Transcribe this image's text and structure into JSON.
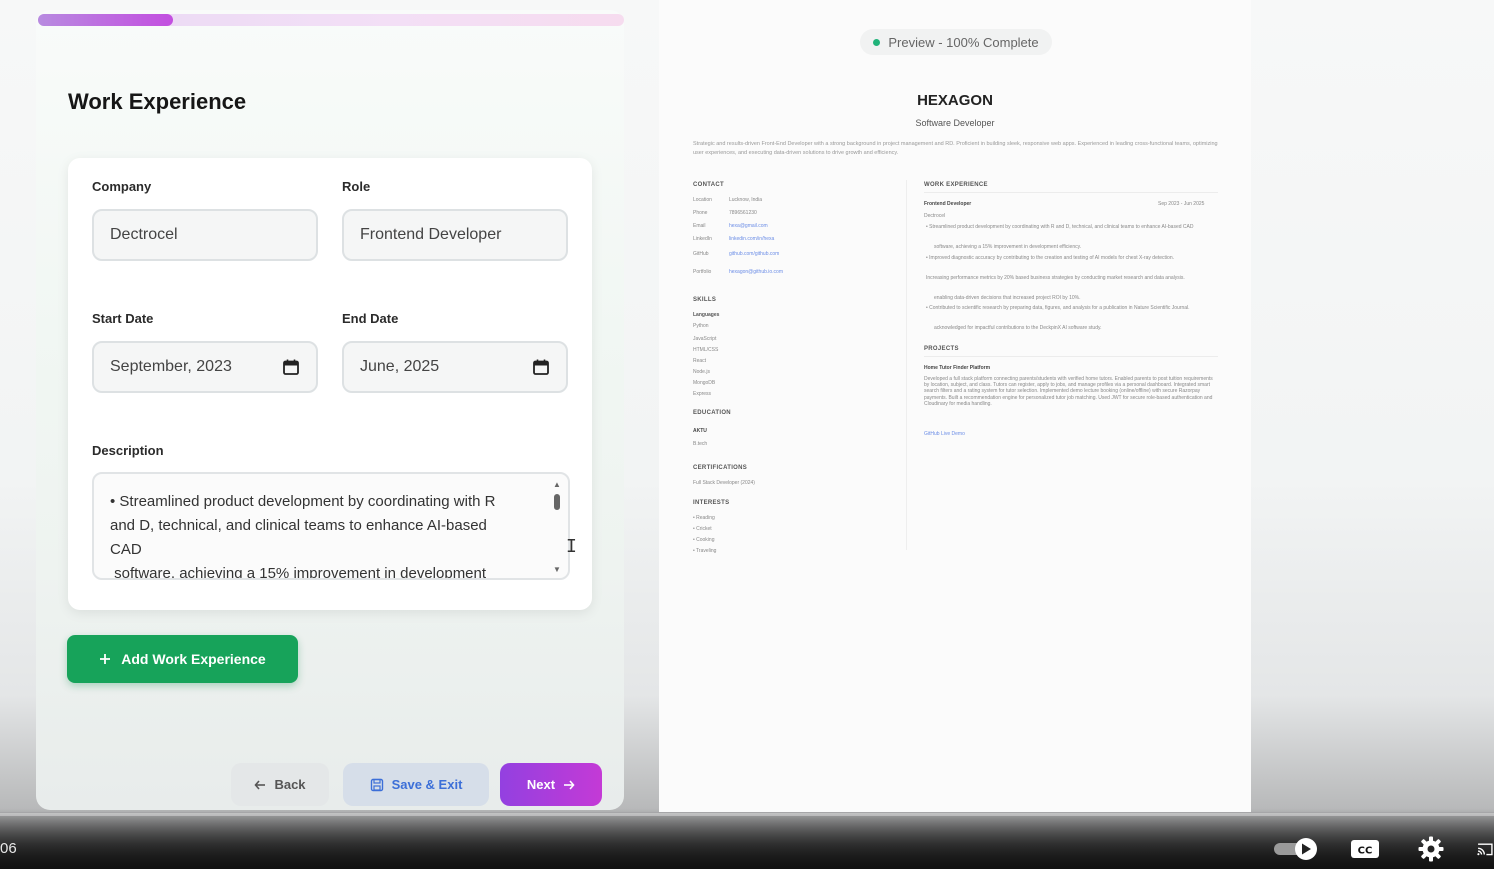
{
  "progress": {
    "fraction": 0.23
  },
  "section": {
    "title": "Work Experience"
  },
  "form": {
    "company_label": "Company",
    "company_value": "Dectrocel",
    "role_label": "Role",
    "role_value": "Frontend Developer",
    "start_label": "Start Date",
    "start_value": "September, 2023",
    "end_label": "End Date",
    "end_value": "June, 2025",
    "description_label": "Description",
    "description_value": "• Streamlined product development by coordinating with R\nand D, technical, and clinical teams to enhance AI-based\nCAD\n software, achieving a 15% improvement in development"
  },
  "buttons": {
    "add": "Add Work Experience",
    "back": "Back",
    "save": "Save & Exit",
    "next": "Next"
  },
  "icons": {
    "calendar": "calendar-icon",
    "plus": "plus-icon",
    "arrow_left": "arrow-left-icon",
    "save": "save-icon",
    "arrow_right": "arrow-right-icon"
  },
  "colors": {
    "accent_green": "#17a35a",
    "accent_purple": "#9340e0",
    "save_blue": "#3c6fd8",
    "preview_dot": "#21b37a"
  },
  "preview": {
    "badge": "Preview - 100% Complete",
    "name": "HEXAGON",
    "role": "Software Developer",
    "summary": "Strategic and results-driven Front-End Developer with a strong background in project management and RD. Proficient in building sleek, responsive web apps. Experienced in leading cross-functional teams, optimizing user experiences, and executing data-driven solutions to drive growth and efficiency.",
    "contact_heading": "CONTACT",
    "contact": [
      {
        "label": "Location",
        "value": "Lucknow, India"
      },
      {
        "label": "Phone",
        "value": "7896561230"
      },
      {
        "label": "Email",
        "value": "hexa@gmail.com"
      },
      {
        "label": "LinkedIn",
        "value": "linkedin.com/in/hexa"
      },
      {
        "label": "GitHub",
        "value": "github.com/github.com"
      },
      {
        "label": "Portfolio",
        "value": "hexagon@github.io.com"
      }
    ],
    "skills_heading": "SKILLS",
    "skills_sub": "Languages",
    "skills": [
      "Python",
      "JavaScript",
      "HTML/CSS",
      "React",
      "Node.js",
      "MongoDB",
      "Express"
    ],
    "education_heading": "EDUCATION",
    "education_school": "AKTU",
    "education_degree": "B.tech",
    "certifications_heading": "CERTIFICATIONS",
    "certification": "Full Stack Developer (2024)",
    "interests_heading": "INTERESTS",
    "interests": [
      "• Reading",
      "• Cricket",
      "• Cooking",
      "• Traveling"
    ],
    "work_heading": "WORK EXPERIENCE",
    "job_title": "Frontend Developer",
    "job_dates": "Sep 2023 - Jun 2025",
    "job_company": "Dectrocel",
    "job_bullets": [
      "• Streamlined product development by coordinating with R and D, technical, and clinical teams to enhance AI-based CAD",
      "software, achieving a 15% improvement in development efficiency.",
      "• Improved diagnostic accuracy by contributing to the creation and testing of AI models for chest X-ray detection.",
      "Increasing performance metrics by 20% based business strategies by conducting market research and data analysis.",
      "enabling data-driven decisions that increased project ROI by 10%.",
      "• Contributed to scientific research by preparing data, figures, and analysis for a publication in Nature Scientific Journal.",
      "acknowledged for impactful contributions to the DeckpinX AI software study."
    ],
    "projects_heading": "PROJECTS",
    "project_title": "Home Tutor Finder Platform",
    "project_desc": "Developed a full stack platform connecting parents/students with verified home tutors. Enabled parents to post tuition requirements by location, subject, and class. Tutors can register, apply to jobs, and manage profiles via a personal dashboard. Integrated smart search filters and a rating system for tutor selection. Implemented demo lecture booking (online/offline) with secure Razorpay payments. Built a recommendation engine for personalized tutor job matching. Used JWT for secure role-based authentication and Cloudinary for media handling.",
    "project_links": "GitHub   Live Demo"
  },
  "video": {
    "time": "06"
  }
}
